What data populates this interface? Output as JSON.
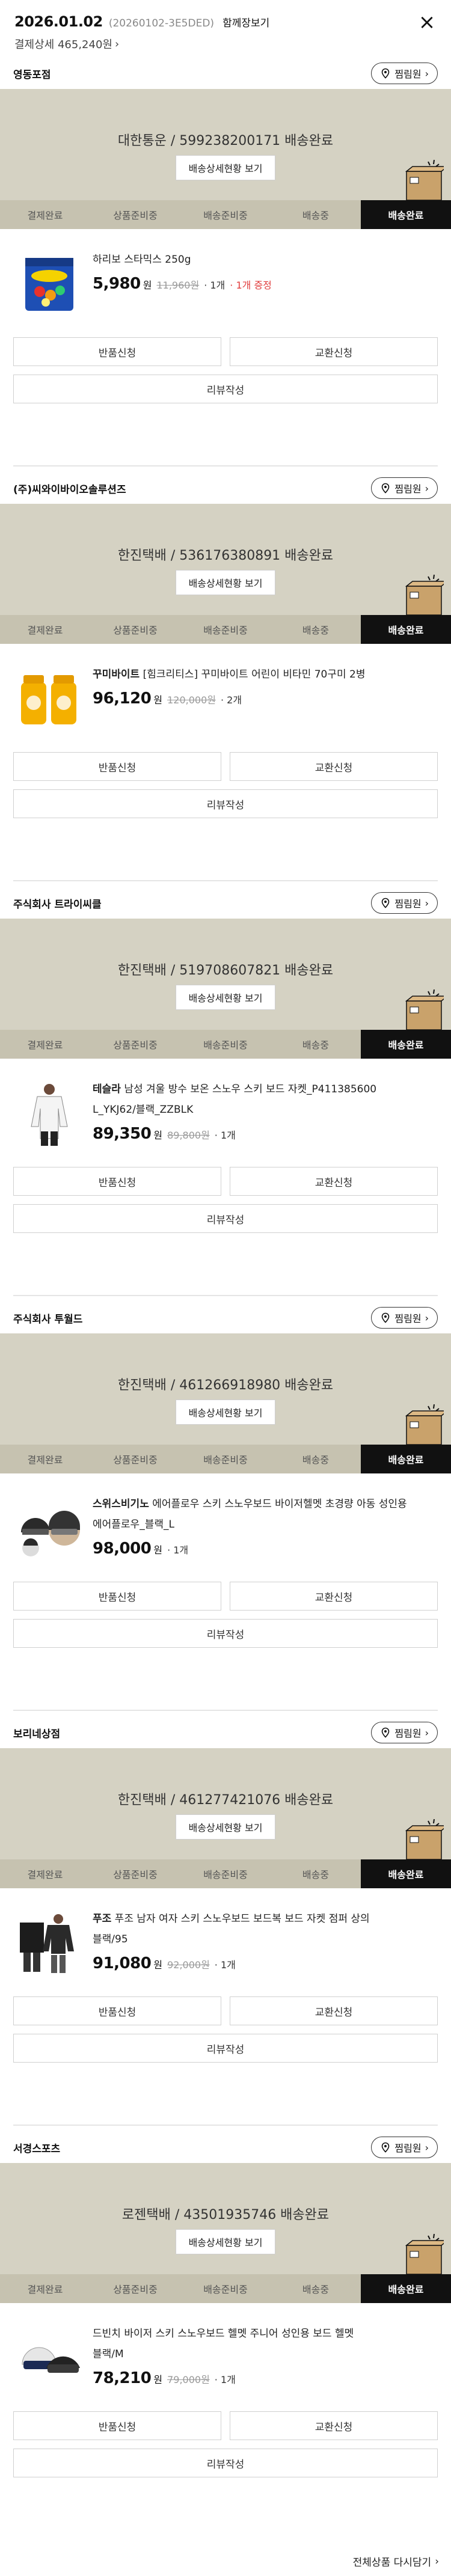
{
  "order": {
    "date": "2026.01.02",
    "order_no": "(20260102-3E5DED)",
    "together_label": "함께장보기",
    "payment_label": "결제상세 465,240원",
    "payment_chevron": "›",
    "close_label": "×"
  },
  "common": {
    "shop_btn_label": "찜림원",
    "shop_btn_chevron": "›",
    "delivery_detail_label": "배송상세현황 보기",
    "steps": [
      "결제완료",
      "상품준비중",
      "배송준비중",
      "배송중",
      "배송완료"
    ],
    "return_label": "반품신청",
    "exchange_label": "교환신청",
    "review_label": "리뷰작성"
  },
  "sections": [
    {
      "seller": "영동포점",
      "delivery": "대한통운 / 599238200171 배송완료",
      "product": {
        "prefix": "",
        "name": "하리보 스타믹스 250g",
        "name_line2": "",
        "price": "5,980",
        "unit": "원",
        "orig": "11,960원",
        "qty": "· 1개",
        "gift": "· 1개 증정"
      }
    },
    {
      "seller": "(주)씨와이바이오솔루션즈",
      "delivery": "한진택배 / 536176380891 배송완료",
      "product": {
        "prefix": "꾸미바이트",
        "name": " [힘크리티스] 꾸미바이트 어린이 비타민 70구미 2병",
        "name_line2": "",
        "price": "96,120",
        "unit": "원",
        "orig": "120,000원",
        "qty": "· 2개",
        "gift": ""
      }
    },
    {
      "seller": "주식회사 트라이씨클",
      "delivery": "한진택배 / 519708607821 배송완료",
      "product": {
        "prefix": "테슬라",
        "name": " 남성 겨울 방수 보온 스노우 스키 보드 자켓_P411385600",
        "name_line2": "L_YKJ62/블랙_ZZBLK",
        "price": "89,350",
        "unit": "원",
        "orig": "89,800원",
        "qty": "· 1개",
        "gift": ""
      }
    },
    {
      "seller": "주식회사 투월드",
      "delivery": "한진택배 / 461266918980 배송완료",
      "product": {
        "prefix": "스위스비기노",
        "name": " 에어플로우 스키 스노우보드 바이저헬멧 초경량 아동 성인용",
        "name_line2": "에어플로우_블랙_L",
        "price": "98,000",
        "unit": "원",
        "orig": "",
        "qty": "· 1개",
        "gift": ""
      }
    },
    {
      "seller": "보리네상점",
      "delivery": "한진택배 / 461277421076 배송완료",
      "product": {
        "prefix": "푸조",
        "name": " 푸조 남자 여자 스키 스노우보드 보드복 보드 자켓 점퍼 상의",
        "name_line2": "블랙/95",
        "price": "91,080",
        "unit": "원",
        "orig": "92,000원",
        "qty": "· 1개",
        "gift": ""
      }
    },
    {
      "seller": "서경스포츠",
      "delivery": "로젠택배 / 43501935746 배송완료",
      "product": {
        "prefix": "",
        "name": "드빈치 바이저 스키 스노우보드 헬멧 주니어 성인용 보드 헬멧",
        "name_line2": "블랙/M",
        "price": "78,210",
        "unit": "원",
        "orig": "79,000원",
        "qty": "· 1개",
        "gift": ""
      }
    }
  ],
  "footer": {
    "reorder_label": "전체상품 다시담기",
    "chevron": "›"
  }
}
